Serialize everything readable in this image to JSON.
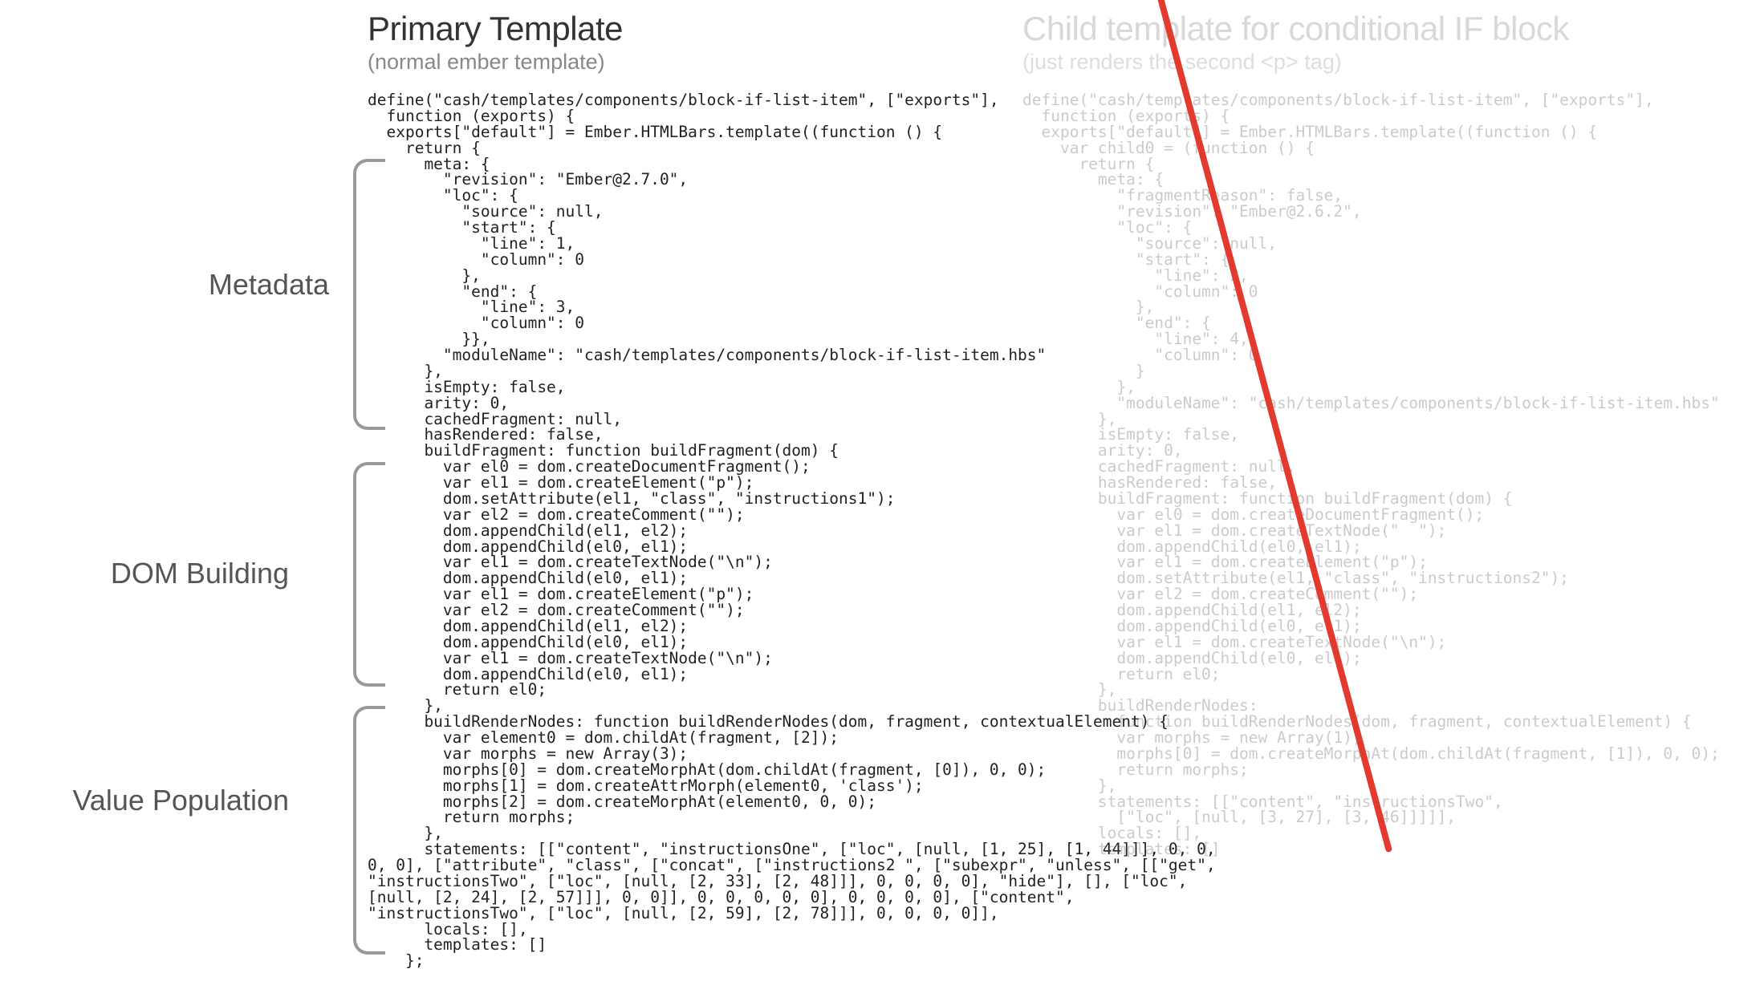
{
  "left": {
    "title": "Primary Template",
    "subtitle": "(normal ember template)",
    "code": "define(\"cash/templates/components/block-if-list-item\", [\"exports\"],\n  function (exports) {\n  exports[\"default\"] = Ember.HTMLBars.template((function () {\n    return {\n      meta: {\n        \"revision\": \"Ember@2.7.0\",\n        \"loc\": {\n          \"source\": null,\n          \"start\": {\n            \"line\": 1,\n            \"column\": 0\n          },\n          \"end\": {\n            \"line\": 3,\n            \"column\": 0\n          }},\n        \"moduleName\": \"cash/templates/components/block-if-list-item.hbs\"\n      },\n      isEmpty: false,\n      arity: 0,\n      cachedFragment: null,\n      hasRendered: false,\n      buildFragment: function buildFragment(dom) {\n        var el0 = dom.createDocumentFragment();\n        var el1 = dom.createElement(\"p\");\n        dom.setAttribute(el1, \"class\", \"instructions1\");\n        var el2 = dom.createComment(\"\");\n        dom.appendChild(el1, el2);\n        dom.appendChild(el0, el1);\n        var el1 = dom.createTextNode(\"\\n\");\n        dom.appendChild(el0, el1);\n        var el1 = dom.createElement(\"p\");\n        var el2 = dom.createComment(\"\");\n        dom.appendChild(el1, el2);\n        dom.appendChild(el0, el1);\n        var el1 = dom.createTextNode(\"\\n\");\n        dom.appendChild(el0, el1);\n        return el0;\n      },\n      buildRenderNodes: function buildRenderNodes(dom, fragment, contextualElement) {\n        var element0 = dom.childAt(fragment, [2]);\n        var morphs = new Array(3);\n        morphs[0] = dom.createMorphAt(dom.childAt(fragment, [0]), 0, 0);\n        morphs[1] = dom.createAttrMorph(element0, 'class');\n        morphs[2] = dom.createMorphAt(element0, 0, 0);\n        return morphs;\n      },\n      statements: [[\"content\", \"instructionsOne\", [\"loc\", [null, [1, 25], [1, 44]]], 0, 0,\n0, 0], [\"attribute\", \"class\", [\"concat\", [\"instructions2 \", [\"subexpr\", \"unless\", [[\"get\",\n\"instructionsTwo\", [\"loc\", [null, [2, 33], [2, 48]]], 0, 0, 0, 0], \"hide\"], [], [\"loc\",\n[null, [2, 24], [2, 57]]], 0, 0]], 0, 0, 0, 0, 0], 0, 0, 0, 0], [\"content\",\n\"instructionsTwo\", [\"loc\", [null, [2, 59], [2, 78]]], 0, 0, 0, 0]],\n      locals: [],\n      templates: []\n    };"
  },
  "right": {
    "title": "Child template for conditional IF block",
    "subtitle": "(just renders the second <p> tag)",
    "code": "define(\"cash/templates/components/block-if-list-item\", [\"exports\"],\n  function (exports) {\n  exports[\"default\"] = Ember.HTMLBars.template((function () {\n    var child0 = (function () {\n      return {\n        meta: {\n          \"fragmentReason\": false,\n          \"revision\": \"Ember@2.6.2\",\n          \"loc\": {\n            \"source\": null,\n            \"start\": {\n              \"line\": 2,\n              \"column\": 0\n            },\n            \"end\": {\n              \"line\": 4,\n              \"column\": 0\n            }\n          },\n          \"moduleName\": \"cash/templates/components/block-if-list-item.hbs\"\n        },\n        isEmpty: false,\n        arity: 0,\n        cachedFragment: null,\n        hasRendered: false,\n        buildFragment: function buildFragment(dom) {\n          var el0 = dom.createDocumentFragment();\n          var el1 = dom.createTextNode(\"  \");\n          dom.appendChild(el0, el1);\n          var el1 = dom.createElement(\"p\");\n          dom.setAttribute(el1, \"class\", \"instructions2\");\n          var el2 = dom.createComment(\"\");\n          dom.appendChild(el1, el2);\n          dom.appendChild(el0, el1);\n          var el1 = dom.createTextNode(\"\\n\");\n          dom.appendChild(el0, el1);\n          return el0;\n        },\n        buildRenderNodes:\n          function buildRenderNodes(dom, fragment, contextualElement) {\n          var morphs = new Array(1);\n          morphs[0] = dom.createMorphAt(dom.childAt(fragment, [1]), 0, 0);\n          return morphs;\n        },\n        statements: [[\"content\", \"instructionsTwo\",\n          [\"loc\", [null, [3, 27], [3, 46]]]]],\n        locals: [],\n        templates: []"
  },
  "annotations": {
    "metadata": "Metadata",
    "dom": "DOM Building",
    "values": "Value Population"
  }
}
